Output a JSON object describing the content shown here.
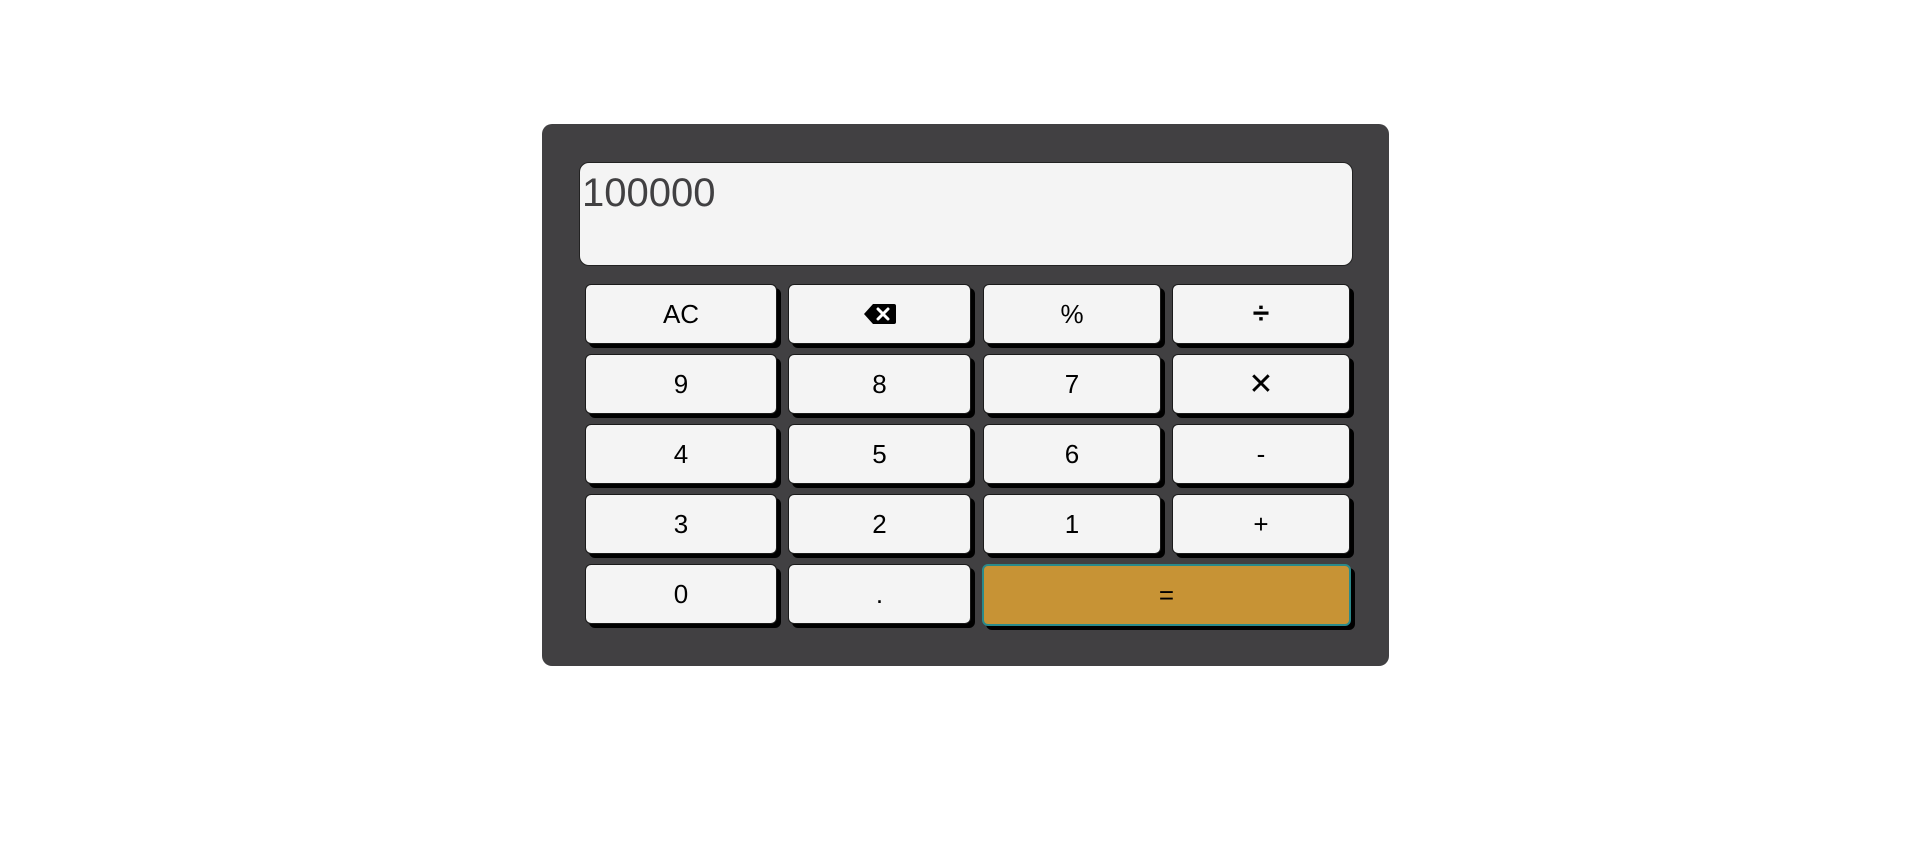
{
  "display": {
    "value": "100000"
  },
  "keys": {
    "clear": "AC",
    "backspace_icon": "backspace-icon",
    "percent": "%",
    "divide": "÷",
    "nine": "9",
    "eight": "8",
    "seven": "7",
    "multiply": "✕",
    "four": "4",
    "five": "5",
    "six": "6",
    "subtract": "-",
    "three": "3",
    "two": "2",
    "one": "1",
    "add": "+",
    "zero": "0",
    "decimal": ".",
    "equals": "="
  },
  "colors": {
    "body": "#414042",
    "key": "#f4f4f4",
    "equals": "#c79335",
    "display_text": "#414042"
  }
}
